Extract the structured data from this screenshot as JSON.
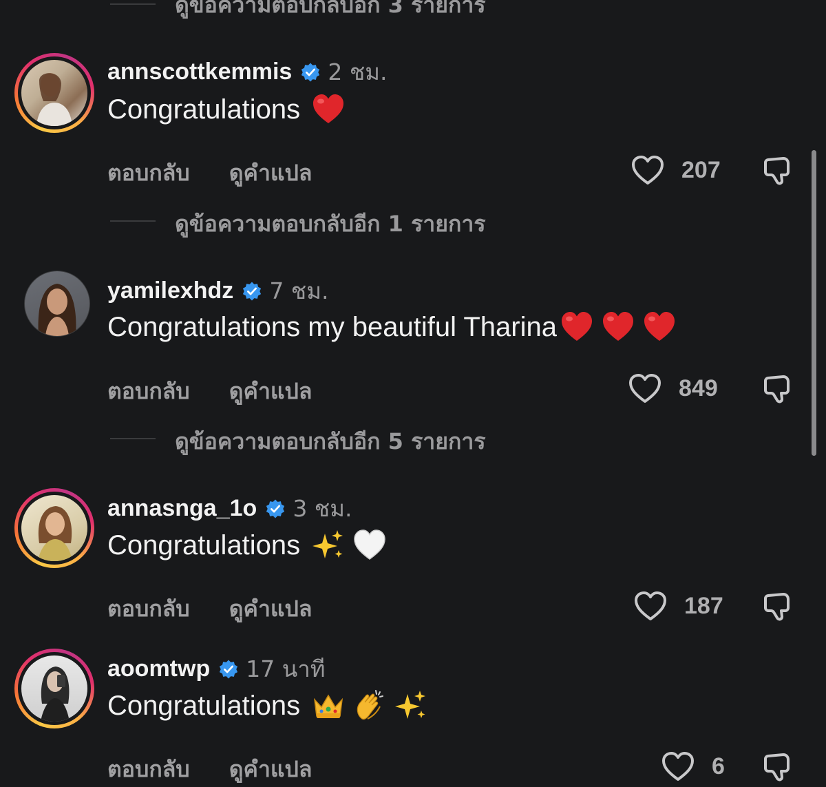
{
  "top_more_replies": "ดูข้อความตอบกลับอีก 3 รายการ",
  "actions": {
    "reply": "ตอบกลับ",
    "translate": "ดูคำแปล"
  },
  "comments": [
    {
      "username": "annscottkemmis",
      "time": "2 ชม.",
      "text": "Congratulations",
      "emoji": [
        "red-heart"
      ],
      "likes": "207",
      "more_replies": "ดูข้อความตอบกลับอีก 1 รายการ",
      "story_ring": true
    },
    {
      "username": "yamilexhdz",
      "time": "7 ชม.",
      "text": "Congratulations my beautiful Tharina",
      "emoji": [
        "red-heart",
        "red-heart",
        "red-heart"
      ],
      "likes": "849",
      "more_replies": "ดูข้อความตอบกลับอีก 5 รายการ",
      "story_ring": false
    },
    {
      "username": "annasnga_1o",
      "time": "3 ชม.",
      "text": "Congratulations",
      "emoji": [
        "sparkles",
        "white-heart"
      ],
      "likes": "187",
      "story_ring": true
    },
    {
      "username": "aoomtwp",
      "time": "17 นาที",
      "text": "Congratulations",
      "emoji": [
        "crown",
        "clapping-hands",
        "sparkles"
      ],
      "likes": "6",
      "story_ring": true
    }
  ],
  "colors": {
    "background": "#18191b",
    "verified": "#3897f0",
    "heart": "#e0262b",
    "muted": "#9a9a9c"
  }
}
